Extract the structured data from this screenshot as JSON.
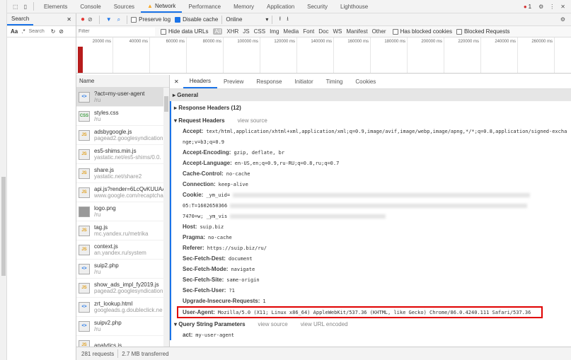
{
  "tabs": [
    "Elements",
    "Console",
    "Sources",
    "Network",
    "Performance",
    "Memory",
    "Application",
    "Security",
    "Lighthouse"
  ],
  "active_tab": "Network",
  "error_count": "1",
  "search": {
    "tab": "Search",
    "placeholder": "Search",
    "aa": "Aa",
    "regex": ".*"
  },
  "toolbar": {
    "preserve_log": "Preserve log",
    "preserve_log_checked": false,
    "disable_cache": "Disable cache",
    "disable_cache_checked": true,
    "throttle": "Online"
  },
  "filter": {
    "placeholder": "Filter",
    "hide_data_urls": "Hide data URLs",
    "types": [
      "All",
      "XHR",
      "JS",
      "CSS",
      "Img",
      "Media",
      "Font",
      "Doc",
      "WS",
      "Manifest",
      "Other"
    ],
    "has_blocked_cookies": "Has blocked cookies",
    "blocked_requests": "Blocked Requests"
  },
  "timeline": {
    "ticks": [
      "20000 ms",
      "40000 ms",
      "60000 ms",
      "80000 ms",
      "100000 ms",
      "120000 ms",
      "140000 ms",
      "160000 ms",
      "180000 ms",
      "200000 ms",
      "220000 ms",
      "240000 ms",
      "260000 ms"
    ]
  },
  "list": {
    "header": "Name",
    "items": [
      {
        "name": "?act=my-user-agent",
        "sub": "/ru",
        "type": "doc"
      },
      {
        "name": "styles.css",
        "sub": "/ru",
        "type": "css"
      },
      {
        "name": "adsbygoogle.js",
        "sub": "pagead2.googlesyndication",
        "type": "js"
      },
      {
        "name": "es5-shims.min.js",
        "sub": "yastatic.net/es5-shims/0.0.",
        "type": "js"
      },
      {
        "name": "share.js",
        "sub": "yastatic.net/share2",
        "type": "js"
      },
      {
        "name": "api.js?render=6LcQvKUUAA",
        "sub": "www.google.com/recaptcha",
        "type": "js"
      },
      {
        "name": "logo.png",
        "sub": "/ru",
        "type": "img"
      },
      {
        "name": "tag.js",
        "sub": "mc.yandex.ru/metrika",
        "type": "js"
      },
      {
        "name": "context.js",
        "sub": "an.yandex.ru/system",
        "type": "js"
      },
      {
        "name": "suip2.php",
        "sub": "/ru",
        "type": "doc"
      },
      {
        "name": "show_ads_impl_fy2019.js",
        "sub": "pagead2.googlesyndication",
        "type": "js"
      },
      {
        "name": "zrt_lookup.html",
        "sub": "googleads.g.doubleclick.ne",
        "type": "doc"
      },
      {
        "name": "suipv2.php",
        "sub": "/ru",
        "type": "doc"
      },
      {
        "name": "analytics.js",
        "sub": "",
        "type": "js"
      }
    ]
  },
  "footer": {
    "requests": "281 requests",
    "transferred": "2.7 MB transferred"
  },
  "details": {
    "tabs": [
      "Headers",
      "Preview",
      "Response",
      "Initiator",
      "Timing",
      "Cookies"
    ],
    "general": "General",
    "response_headers": "Response Headers (12)",
    "request_headers": "Request Headers",
    "view_source": "view source",
    "headers": [
      {
        "k": "Accept:",
        "v": "text/html,application/xhtml+xml,application/xml;q=0.9,image/avif,image/webp,image/apng,*/*;q=0.8,application/signed-excha"
      },
      {
        "k": "",
        "v": "nge;v=b3;q=0.9"
      },
      {
        "k": "Accept-Encoding:",
        "v": "gzip, deflate, br"
      },
      {
        "k": "Accept-Language:",
        "v": "en-US,en;q=0.9,ru-RU;q=0.8,ru;q=0.7"
      },
      {
        "k": "Cache-Control:",
        "v": "no-cache"
      },
      {
        "k": "Connection:",
        "v": "keep-alive"
      },
      {
        "k": "Cookie:",
        "v": "_ym_uid="
      },
      {
        "k": "",
        "v": "05:T=1602650366"
      },
      {
        "k": "",
        "v": "7470=w; _ym_vis"
      },
      {
        "k": "Host:",
        "v": "suip.biz"
      },
      {
        "k": "Pragma:",
        "v": "no-cache"
      },
      {
        "k": "Referer:",
        "v": "https://suip.biz/ru/"
      },
      {
        "k": "Sec-Fetch-Dest:",
        "v": "document"
      },
      {
        "k": "Sec-Fetch-Mode:",
        "v": "navigate"
      },
      {
        "k": "Sec-Fetch-Site:",
        "v": "same-origin"
      },
      {
        "k": "Sec-Fetch-User:",
        "v": "?1"
      },
      {
        "k": "Upgrade-Insecure-Requests:",
        "v": "1"
      }
    ],
    "user_agent": {
      "k": "User-Agent:",
      "v": "Mozilla/5.0 (X11; Linux x86_64) AppleWebKit/537.36 (KHTML, like Gecko) Chrome/86.0.4240.111 Safari/537.36"
    },
    "query": {
      "title": "Query String Parameters",
      "view_source": "view source",
      "view_url_encoded": "view URL encoded",
      "params": [
        {
          "k": "act:",
          "v": "my-user-agent"
        }
      ]
    }
  },
  "colors": {
    "accent": "#1a73e8",
    "highlight_box": "#e00000",
    "record": "#e53935"
  }
}
